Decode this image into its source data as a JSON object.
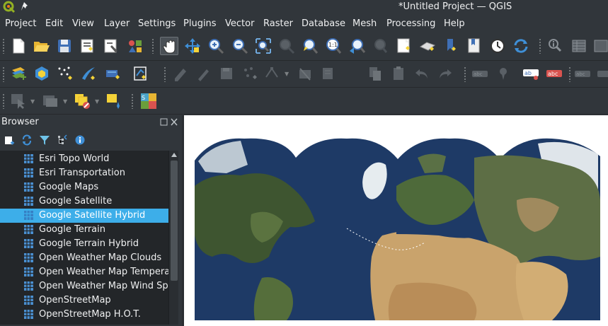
{
  "window": {
    "title": "*Untitled Project — QGIS",
    "app_icon": "qgis-logo-icon",
    "pin_icon": "pin-icon"
  },
  "menu": [
    {
      "label": "Project"
    },
    {
      "label": "Edit"
    },
    {
      "label": "View"
    },
    {
      "label": "Layer"
    },
    {
      "label": "Settings"
    },
    {
      "label": "Plugins"
    },
    {
      "label": "Vector"
    },
    {
      "label": "Raster"
    },
    {
      "label": "Database"
    },
    {
      "label": "Mesh"
    },
    {
      "label": "Processing"
    },
    {
      "label": "Help"
    }
  ],
  "toolbars": {
    "project": [
      "new-project-icon",
      "open-project-icon",
      "save-project-icon",
      "new-print-layout-icon",
      "show-layout-manager-icon",
      "style-manager-icon"
    ],
    "map_navigation": [
      "pan-map-icon",
      "pan-to-selection-icon",
      "zoom-in-icon",
      "zoom-out-icon",
      "zoom-full-icon",
      "zoom-to-selection-icon",
      "zoom-to-layer-icon",
      "zoom-to-native-resolution-icon",
      "zoom-last-icon",
      "zoom-next-icon",
      "new-map-view-icon",
      "new-3d-map-view-icon",
      "new-bookmark-icon",
      "show-bookmarks-icon",
      "temporal-controller-icon",
      "refresh-icon"
    ],
    "attributes": [
      "identify-features-icon",
      "open-attribute-table-icon"
    ],
    "data_source": [
      "data-source-manager-icon",
      "new-geopackage-layer-icon",
      "new-shapefile-layer-icon",
      "new-spatialite-layer-icon",
      "new-virtual-layer-icon",
      "new-temporary-layer-icon"
    ],
    "digitizing": [
      "toggle-editing-icon",
      "current-edits-icon",
      "save-edits-icon",
      "add-feature-icon",
      "vertex-tool-icon",
      "delete-selected-icon",
      "cut-features-icon",
      "copy-features-icon",
      "paste-features-icon",
      "undo-icon",
      "redo-icon"
    ],
    "labels": [
      "label-toolbar-icon",
      "pin-label-icon",
      "show-hide-labels-icon",
      "highlight-pinned-labels-icon",
      "move-label-icon",
      "rotate-label-icon"
    ],
    "selection": [
      "select-features-icon",
      "select-by-value-icon",
      "deselect-all-icon",
      "show-map-tips-icon"
    ],
    "plugins": [
      "quickmapservices-icon"
    ]
  },
  "browser": {
    "title": "Browser",
    "tools": [
      "add-selected-layers-icon",
      "refresh-icon",
      "filter-browser-icon",
      "collapse-all-icon",
      "enable-properties-icon"
    ],
    "items": [
      {
        "label": "Esri Topo World",
        "icon": "xyz-tile-icon",
        "selected": false
      },
      {
        "label": "Esri Transportation",
        "icon": "xyz-tile-icon",
        "selected": false
      },
      {
        "label": "Google Maps",
        "icon": "xyz-tile-icon",
        "selected": false
      },
      {
        "label": "Google Satellite",
        "icon": "xyz-tile-icon",
        "selected": false
      },
      {
        "label": "Google Satellite Hybrid",
        "icon": "xyz-tile-icon",
        "selected": true
      },
      {
        "label": "Google Terrain",
        "icon": "xyz-tile-icon",
        "selected": false
      },
      {
        "label": "Google Terrain Hybrid",
        "icon": "xyz-tile-icon",
        "selected": false
      },
      {
        "label": "Open Weather Map Clouds",
        "icon": "xyz-tile-icon",
        "selected": false
      },
      {
        "label": "Open Weather Map Temperatu",
        "icon": "xyz-tile-icon",
        "selected": false
      },
      {
        "label": "Open Weather Map Wind Spee",
        "icon": "xyz-tile-icon",
        "selected": false
      },
      {
        "label": "OpenStreetMap",
        "icon": "xyz-tile-icon",
        "selected": false
      },
      {
        "label": "OpenStreetMap H.O.T.",
        "icon": "xyz-tile-icon",
        "selected": false
      }
    ]
  },
  "map_canvas": {
    "content": "satellite-imagery-map",
    "colors": {
      "ocean": "#1e3a66",
      "land_green": "#4e6a3a",
      "desert": "#c9a36c",
      "ice": "#dfe5ea",
      "blank": "#ffffff"
    }
  }
}
